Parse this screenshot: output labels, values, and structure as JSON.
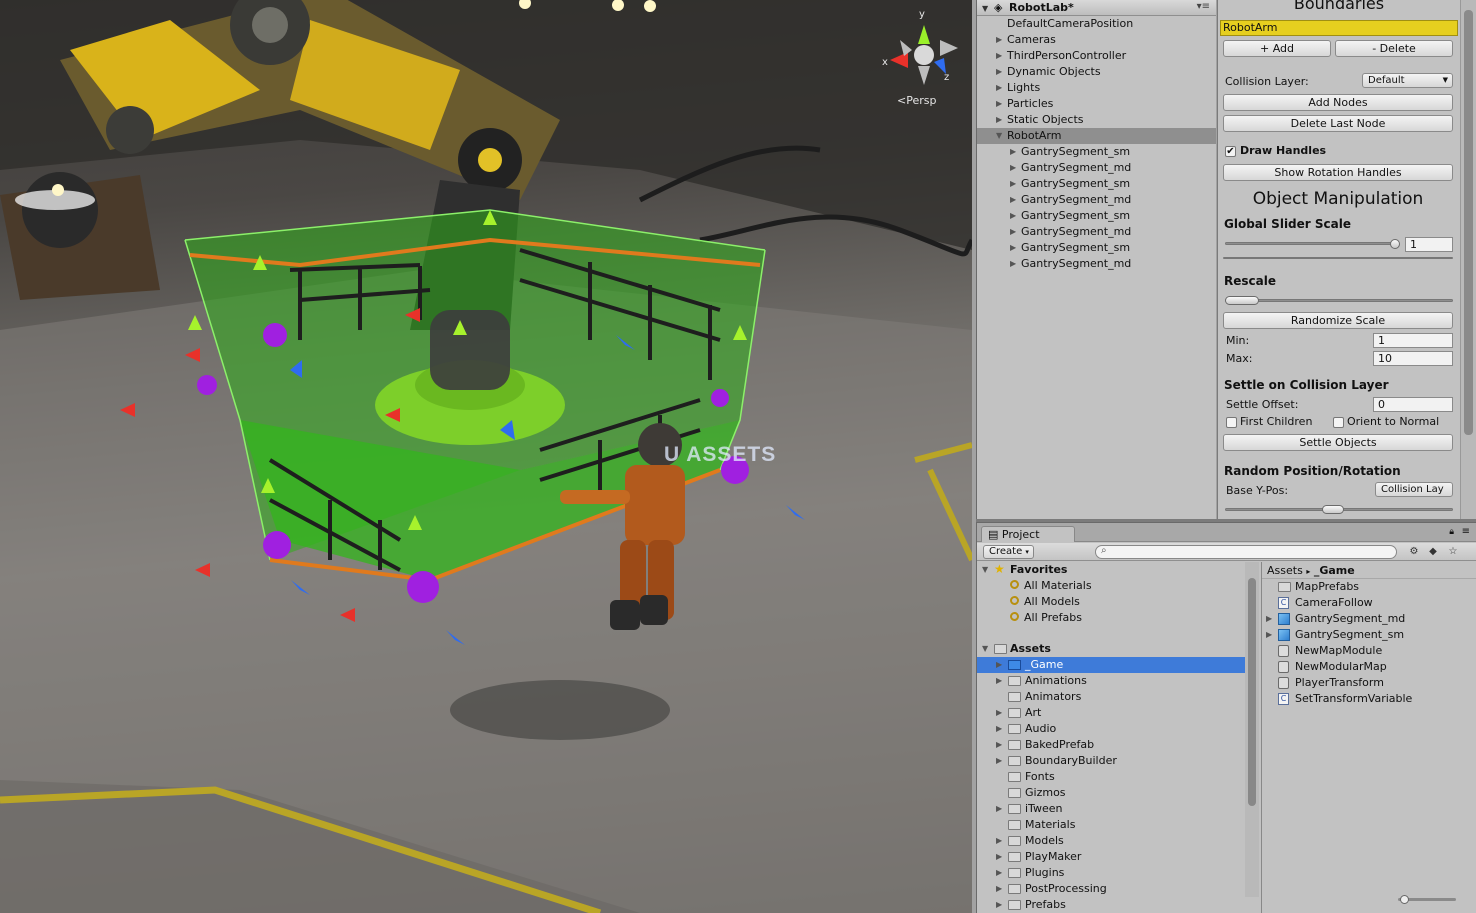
{
  "scene": {
    "persp_label": "Persp",
    "watermark": "U ASSETS",
    "gizmo_axes": {
      "x": "x",
      "y": "y",
      "z": "z"
    }
  },
  "hierarchy": {
    "title": "RobotLab*",
    "items": [
      {
        "label": "DefaultCameraPosition",
        "depth": 1,
        "expandable": false,
        "selected": false
      },
      {
        "label": "Cameras",
        "depth": 1,
        "expandable": true,
        "selected": false
      },
      {
        "label": "ThirdPersonController",
        "depth": 1,
        "expandable": true,
        "selected": false
      },
      {
        "label": "Dynamic Objects",
        "depth": 1,
        "expandable": true,
        "selected": false
      },
      {
        "label": "Lights",
        "depth": 1,
        "expandable": true,
        "selected": false
      },
      {
        "label": "Particles",
        "depth": 1,
        "expandable": true,
        "selected": false
      },
      {
        "label": "Static Objects",
        "depth": 1,
        "expandable": true,
        "selected": false
      },
      {
        "label": "RobotArm",
        "depth": 1,
        "expandable": true,
        "expanded": true,
        "selected": true
      },
      {
        "label": "GantrySegment_sm",
        "depth": 2,
        "expandable": true,
        "selected": false
      },
      {
        "label": "GantrySegment_md",
        "depth": 2,
        "expandable": true,
        "selected": false
      },
      {
        "label": "GantrySegment_sm",
        "depth": 2,
        "expandable": true,
        "selected": false
      },
      {
        "label": "GantrySegment_md",
        "depth": 2,
        "expandable": true,
        "selected": false
      },
      {
        "label": "GantrySegment_sm",
        "depth": 2,
        "expandable": true,
        "selected": false
      },
      {
        "label": "GantrySegment_md",
        "depth": 2,
        "expandable": true,
        "selected": false
      },
      {
        "label": "GantrySegment_sm",
        "depth": 2,
        "expandable": true,
        "selected": false
      },
      {
        "label": "GantrySegment_md",
        "depth": 2,
        "expandable": true,
        "selected": false
      }
    ]
  },
  "inspector": {
    "section_title": "Boundaries",
    "name_value": "RobotArm",
    "add_label": "+ Add",
    "delete_label": "- Delete",
    "collision_layer_label": "Collision Layer:",
    "collision_layer_value": "Default",
    "add_nodes_label": "Add Nodes",
    "delete_last_node_label": "Delete Last Node",
    "draw_handles_label": "Draw Handles",
    "draw_handles_checked": true,
    "show_rotation_handles_label": "Show Rotation Handles",
    "object_manipulation_title": "Object Manipulation",
    "global_slider_scale_label": "Global Slider Scale",
    "global_slider_scale_value": "1",
    "global_slider_scale_fraction": 1.0,
    "rescale_label": "Rescale",
    "randomize_scale_label": "Randomize Scale",
    "min_label": "Min:",
    "min_value": "1",
    "max_label": "Max:",
    "max_value": "10",
    "settle_title": "Settle on Collision Layer",
    "settle_offset_label": "Settle Offset:",
    "settle_offset_value": "0",
    "first_children_label": "First Children",
    "orient_to_normal_label": "Orient to Normal",
    "settle_objects_label": "Settle Objects",
    "random_title": "Random Position/Rotation",
    "base_ypos_label": "Base Y-Pos:",
    "base_ypos_value": "Collision Lay"
  },
  "project": {
    "tab_label": "Project",
    "create_label": "Create",
    "favorites_label": "Favorites",
    "favorites": [
      "All Materials",
      "All Models",
      "All Prefabs"
    ],
    "assets_label": "Assets",
    "folders": [
      {
        "label": "_Game",
        "expandable": true,
        "selected": true
      },
      {
        "label": "Animations",
        "expandable": true,
        "selected": false
      },
      {
        "label": "Animators",
        "expandable": false,
        "selected": false
      },
      {
        "label": "Art",
        "expandable": true,
        "selected": false
      },
      {
        "label": "Audio",
        "expandable": true,
        "selected": false
      },
      {
        "label": "BakedPrefab",
        "expandable": true,
        "selected": false
      },
      {
        "label": "BoundaryBuilder",
        "expandable": true,
        "selected": false
      },
      {
        "label": "Fonts",
        "expandable": false,
        "selected": false
      },
      {
        "label": "Gizmos",
        "expandable": false,
        "selected": false
      },
      {
        "label": "iTween",
        "expandable": true,
        "selected": false
      },
      {
        "label": "Materials",
        "expandable": false,
        "selected": false
      },
      {
        "label": "Models",
        "expandable": true,
        "selected": false
      },
      {
        "label": "PlayMaker",
        "expandable": true,
        "selected": false
      },
      {
        "label": "Plugins",
        "expandable": true,
        "selected": false
      },
      {
        "label": "PostProcessing",
        "expandable": true,
        "selected": false
      },
      {
        "label": "Prefabs",
        "expandable": true,
        "selected": false
      }
    ],
    "breadcrumb_root": "Assets",
    "breadcrumb_sep": "▸",
    "breadcrumb_current": "_Game",
    "files": [
      {
        "label": "MapPrefabs",
        "icon": "folder-icon",
        "expandable": false
      },
      {
        "label": "CameraFollow",
        "icon": "script-icon",
        "expandable": false
      },
      {
        "label": "GantrySegment_md",
        "icon": "prefab-icon",
        "expandable": true
      },
      {
        "label": "GantrySegment_sm",
        "icon": "prefab-icon",
        "expandable": true
      },
      {
        "label": "NewMapModule",
        "icon": "asset-icon",
        "expandable": false
      },
      {
        "label": "NewModularMap",
        "icon": "asset-icon",
        "expandable": false
      },
      {
        "label": "PlayerTransform",
        "icon": "asset-icon",
        "expandable": false
      },
      {
        "label": "SetTransformVariable",
        "icon": "script-icon",
        "expandable": false
      }
    ]
  },
  "colors": {
    "selection_blue": "#3e7bd9",
    "name_field_yellow": "#e6cf1f",
    "boundary_green": "#3fb21f",
    "gizmo_red": "#e8312a",
    "gizmo_green": "#9bf02a",
    "gizmo_blue": "#2f6cf0"
  }
}
